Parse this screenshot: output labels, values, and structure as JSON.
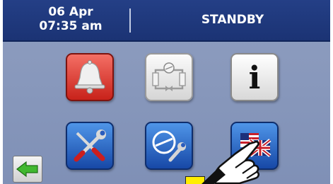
{
  "header": {
    "date": "06 Apr",
    "time": "07:35 am",
    "status": "STANDBY"
  },
  "buttons": [
    {
      "name": "alarm-button",
      "icon": "bell-icon"
    },
    {
      "name": "refrigeration-circuit-button",
      "icon": "refrigeration-circuit-icon"
    },
    {
      "name": "info-button",
      "icon": "info-icon",
      "glyph": "i"
    },
    {
      "name": "service-tools-button",
      "icon": "tools-icon"
    },
    {
      "name": "compressor-settings-button",
      "icon": "compressor-wrench-icon"
    },
    {
      "name": "language-button",
      "icon": "flags-icon"
    }
  ],
  "navigation": {
    "back_icon": "green-left-arrow-icon"
  },
  "colors": {
    "header": "#1f3a7d",
    "panel": "#8798bc",
    "alarm": "#d8342a",
    "blue_button": "#2561c7",
    "back_arrow": "#41b830"
  }
}
